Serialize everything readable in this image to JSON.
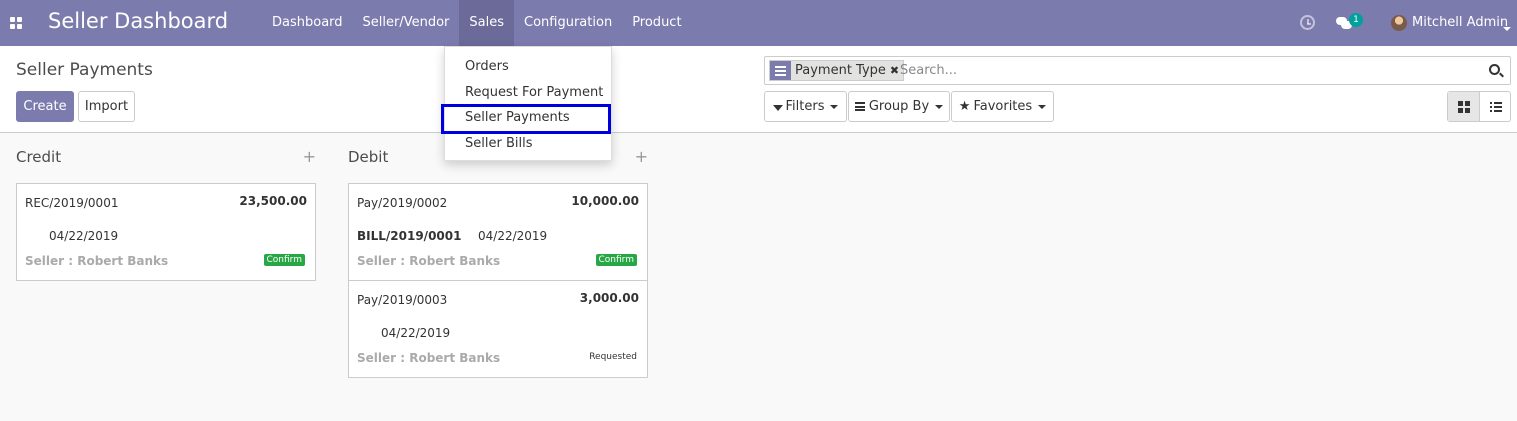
{
  "navbar": {
    "brand": "Seller Dashboard",
    "menu": [
      "Dashboard",
      "Seller/Vendor",
      "Sales",
      "Configuration",
      "Product"
    ],
    "active_menu": "Sales",
    "chat_count": "1",
    "user_name": "Mitchell Admin",
    "color": "#7c7bad"
  },
  "sales_dropdown": {
    "items": [
      "Orders",
      "Request For Payment",
      "Seller Payments",
      "Seller Bills"
    ],
    "highlighted": "Seller Payments"
  },
  "control_panel": {
    "title": "Seller Payments",
    "create_label": "Create",
    "import_label": "Import",
    "search": {
      "facet_value": "Payment Type",
      "placeholder": "Search..."
    },
    "filters_label": "Filters",
    "groupby_label": "Group By",
    "favorites_label": "Favorites",
    "views": [
      "kanban",
      "list"
    ],
    "active_view": "kanban"
  },
  "kanban": {
    "columns": [
      {
        "title": "Credit",
        "cards": [
          {
            "ref": "REC/2019/0001",
            "amount": "23,500.00",
            "bill": "",
            "date": "04/22/2019",
            "seller": "Seller   : Robert Banks",
            "status": "Confirm"
          }
        ]
      },
      {
        "title": "Debit",
        "cards": [
          {
            "ref": "Pay/2019/0002",
            "amount": "10,000.00",
            "bill": "BILL/2019/0001",
            "date": "04/22/2019",
            "seller": "Seller   : Robert Banks",
            "status": "Confirm"
          },
          {
            "ref": "Pay/2019/0003",
            "amount": "3,000.00",
            "bill": "",
            "date": "04/22/2019",
            "seller": "Seller   : Robert Banks",
            "status": "Requested"
          }
        ]
      }
    ],
    "status_colors": {
      "Confirm": "#28a745"
    }
  }
}
